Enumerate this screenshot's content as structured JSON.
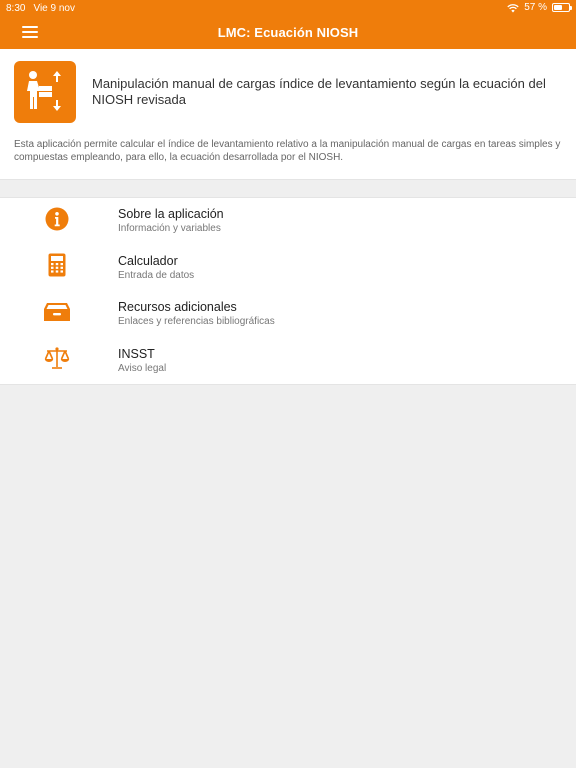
{
  "status_bar": {
    "time": "8:30",
    "date": "Vie 9 nov",
    "battery": "57 %",
    "battery_level": 0.57
  },
  "navbar": {
    "title": "LMC: Ecuación NIOSH",
    "menu_icon": "hamburger-icon"
  },
  "intro": {
    "logo_icon": "person-lifting-box-icon",
    "title": "Manipulación manual de cargas índice de levantamiento según la ecuación del NIOSH revisada",
    "description": "Esta aplicación permite calcular el índice de levantamiento relativo a la manipulación manual de cargas en tareas simples y compuestas empleando, para ello, la ecuación desarrollada por el NIOSH."
  },
  "menu": {
    "items": [
      {
        "label": "Sobre la aplicación",
        "subtitle": "Información y variables",
        "icon": "info-icon"
      },
      {
        "label": "Calculador",
        "subtitle": "Entrada de datos",
        "icon": "calculator-icon"
      },
      {
        "label": "Recursos adicionales",
        "subtitle": "Enlaces y referencias bibliográficas",
        "icon": "archive-box-icon"
      },
      {
        "label": "INSST",
        "subtitle": "Aviso legal",
        "icon": "scale-icon"
      }
    ]
  },
  "colors": {
    "accent": "#ef7d0b",
    "background": "#efefef"
  }
}
